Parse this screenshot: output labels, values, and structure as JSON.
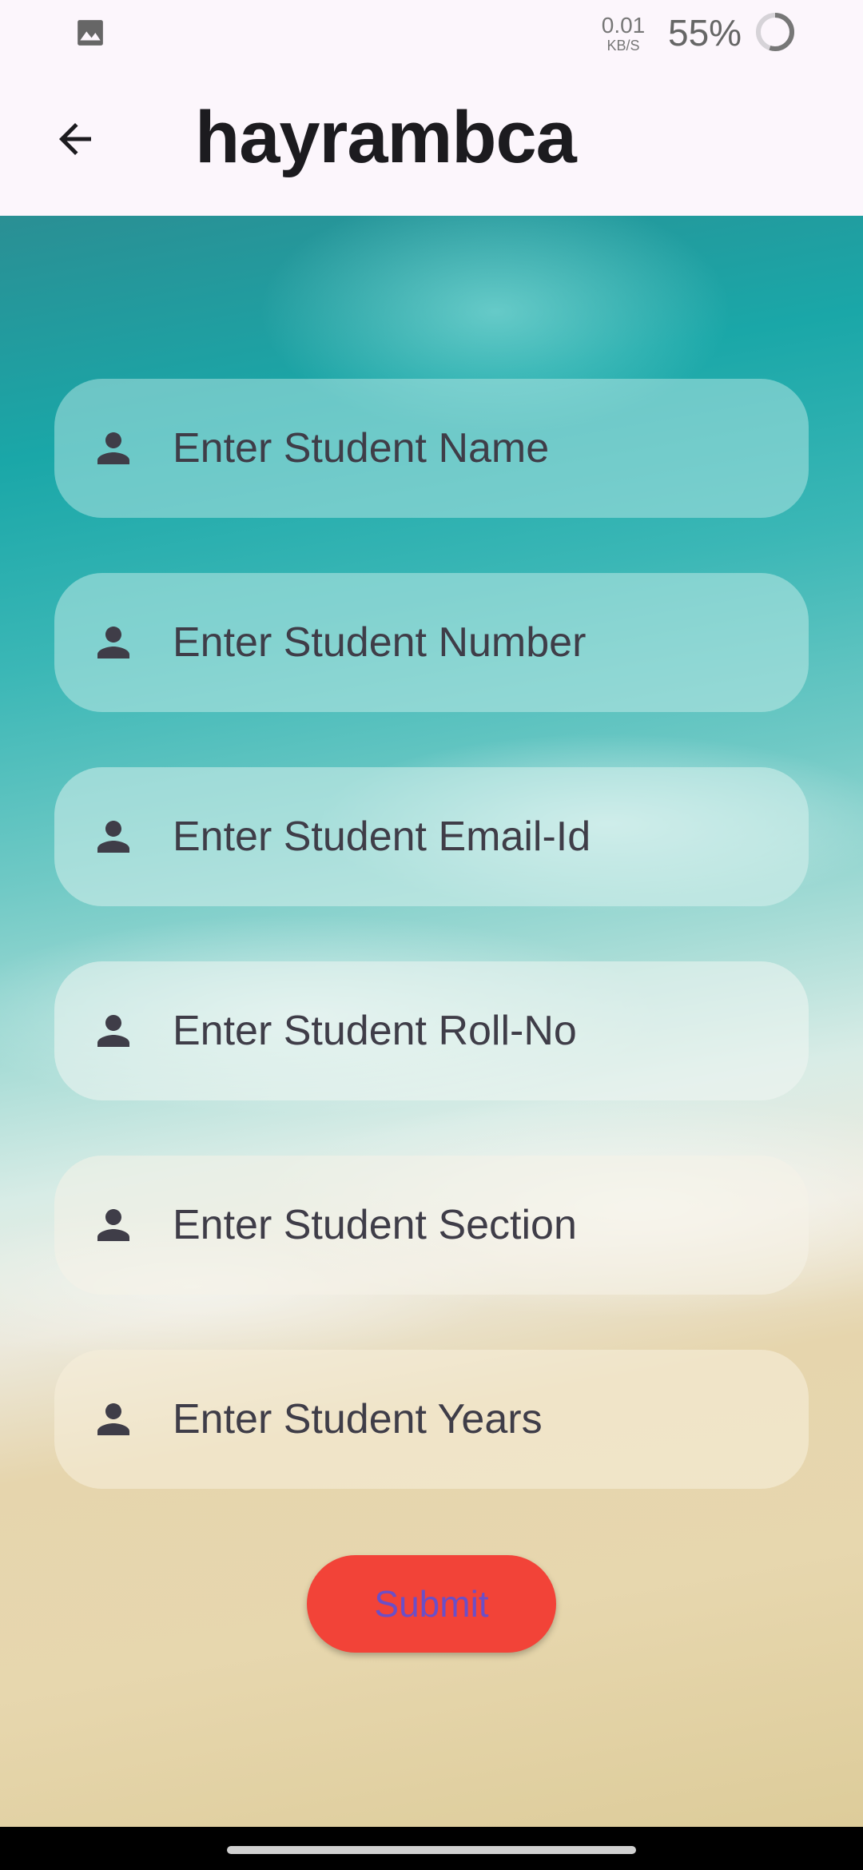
{
  "status_bar": {
    "net_speed_value": "0.01",
    "net_speed_unit": "KB/S",
    "battery_percent": "55%",
    "gallery_icon": "image-icon"
  },
  "app_bar": {
    "title": "hayrambca",
    "back_icon": "arrow-back-icon"
  },
  "form": {
    "fields": [
      {
        "icon": "person-icon",
        "value": "",
        "placeholder": "Enter Student Name"
      },
      {
        "icon": "person-icon",
        "value": "",
        "placeholder": "Enter Student Number"
      },
      {
        "icon": "person-icon",
        "value": "",
        "placeholder": "Enter Student Email-Id"
      },
      {
        "icon": "person-icon",
        "value": "",
        "placeholder": "Enter Student Roll-No"
      },
      {
        "icon": "person-icon",
        "value": "",
        "placeholder": "Enter Student Section"
      },
      {
        "icon": "person-icon",
        "value": "",
        "placeholder": "Enter Student Years"
      }
    ],
    "submit_label": "Submit"
  },
  "colors": {
    "submit_background": "#f24338",
    "submit_text": "#6b4fc7",
    "appbar_background": "#fcf6fc",
    "placeholder_text": "#3f3d48"
  }
}
